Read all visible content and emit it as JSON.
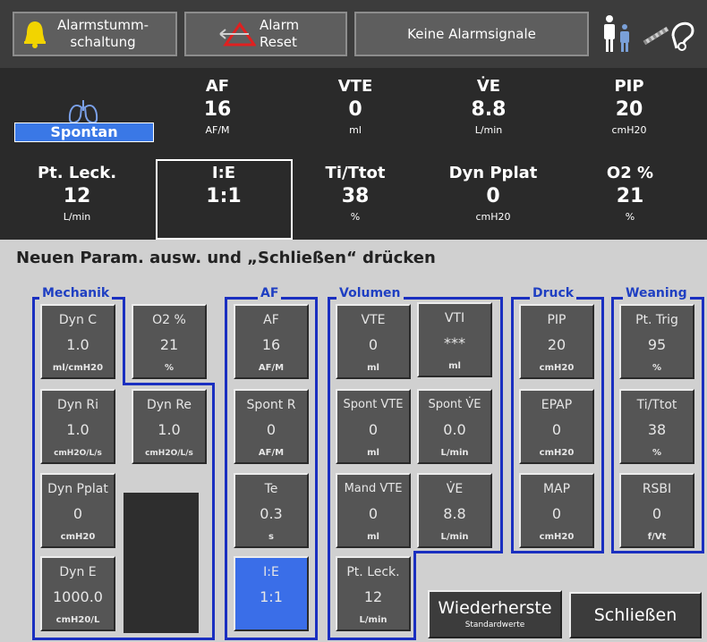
{
  "toolbar": {
    "silence_label": "Alarmstumm-\nschaltung",
    "reset_label": "Alarm\nReset",
    "alarm_status": "Keine Alarmsignale"
  },
  "monitor": {
    "mode": "Spontan",
    "cells": [
      {
        "label": "AF",
        "value": "16",
        "unit": "AF/M"
      },
      {
        "label": "VTE",
        "value": "0",
        "unit": "ml"
      },
      {
        "label": "V̇E",
        "value": "8.8",
        "unit": "L/min"
      },
      {
        "label": "PIP",
        "value": "20",
        "unit": "cmH20"
      },
      {
        "label": "Pt. Leck.",
        "value": "12",
        "unit": "L/min"
      },
      {
        "label": "I:E",
        "value": "1:1",
        "unit": ""
      },
      {
        "label": "Ti/Ttot",
        "value": "38",
        "unit": "%"
      },
      {
        "label": "Dyn Pplat",
        "value": "0",
        "unit": "cmH20"
      },
      {
        "label": "O2 %",
        "value": "21",
        "unit": "%"
      }
    ]
  },
  "instruction": "Neuen Param. ausw. und „Schließen“ drücken",
  "groups": {
    "mechanik": "Mechanik",
    "af": "AF",
    "volumen": "Volumen",
    "druck": "Druck",
    "weaning": "Weaning"
  },
  "params": {
    "dyn_c": {
      "label": "Dyn C",
      "value": "1.0",
      "unit": "ml/cmH20"
    },
    "o2": {
      "label": "O2 %",
      "value": "21",
      "unit": "%"
    },
    "dyn_ri": {
      "label": "Dyn Ri",
      "value": "1.0",
      "unit": "cmH2O/L/s"
    },
    "dyn_re": {
      "label": "Dyn Re",
      "value": "1.0",
      "unit": "cmH2O/L/s"
    },
    "dyn_pplat": {
      "label": "Dyn Pplat",
      "value": "0",
      "unit": "cmH20"
    },
    "dyn_e": {
      "label": "Dyn E",
      "value": "1000.0",
      "unit": "cmH20/L"
    },
    "af": {
      "label": "AF",
      "value": "16",
      "unit": "AF/M"
    },
    "spont_r": {
      "label": "Spont R",
      "value": "0",
      "unit": "AF/M"
    },
    "te": {
      "label": "Te",
      "value": "0.3",
      "unit": "s"
    },
    "ie": {
      "label": "I:E",
      "value": "1:1",
      "unit": ""
    },
    "vte": {
      "label": "VTE",
      "value": "0",
      "unit": "ml"
    },
    "vti": {
      "label": "VTI",
      "value": "***",
      "unit": "ml"
    },
    "spont_vte": {
      "label": "Spont VTE",
      "value": "0",
      "unit": "ml"
    },
    "spont_ve": {
      "label": "Spont V̇E",
      "value": "0.0",
      "unit": "L/min"
    },
    "mand_vte": {
      "label": "Mand VTE",
      "value": "0",
      "unit": "ml"
    },
    "ve": {
      "label": "V̇E",
      "value": "8.8",
      "unit": "L/min"
    },
    "pt_leck": {
      "label": "Pt. Leck.",
      "value": "12",
      "unit": "L/min"
    },
    "pip": {
      "label": "PIP",
      "value": "20",
      "unit": "cmH20"
    },
    "epap": {
      "label": "EPAP",
      "value": "0",
      "unit": "cmH20"
    },
    "map": {
      "label": "MAP",
      "value": "0",
      "unit": "cmH20"
    },
    "pt_trig": {
      "label": "Pt. Trig",
      "value": "95",
      "unit": "%"
    },
    "ti_ttot": {
      "label": "Ti/Ttot",
      "value": "38",
      "unit": "%"
    },
    "rsbi": {
      "label": "RSBI",
      "value": "0",
      "unit": "f/Vt"
    }
  },
  "buttons": {
    "restore_label": "Wiederherste",
    "restore_sub": "Standardwerte",
    "close_label": "Schließen"
  },
  "colors": {
    "selected": "#3a6ee8",
    "group_line": "#1a2fc0",
    "alarm_bell": "#f2d400",
    "mode_badge": "#3a78e6"
  }
}
